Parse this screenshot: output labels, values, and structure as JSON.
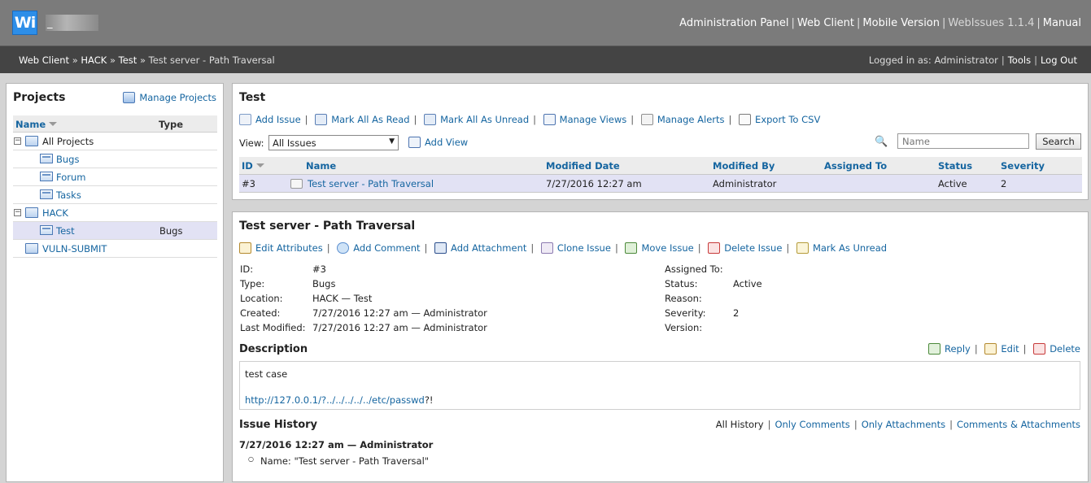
{
  "header": {
    "logo": "Wi",
    "site_title": "_",
    "links": [
      "Administration Panel",
      "Web Client",
      "Mobile Version"
    ],
    "version": "WebIssues 1.1.4",
    "manual": "Manual"
  },
  "breadcrumb": {
    "items": [
      "Web Client",
      "HACK",
      "Test"
    ],
    "current": "Test server - Path Traversal",
    "separator": "»"
  },
  "user": {
    "logged_in": "Logged in as: Administrator",
    "tools": "Tools",
    "logout": "Log Out"
  },
  "projects": {
    "title": "Projects",
    "manage": "Manage Projects",
    "col_name": "Name",
    "col_type": "Type",
    "rows": [
      {
        "label": "All Projects",
        "type": ""
      },
      {
        "label": "Bugs",
        "type": ""
      },
      {
        "label": "Forum",
        "type": ""
      },
      {
        "label": "Tasks",
        "type": ""
      },
      {
        "label": "HACK",
        "type": ""
      },
      {
        "label": "Test",
        "type": "Bugs"
      },
      {
        "label": "VULN-SUBMIT",
        "type": ""
      }
    ]
  },
  "list": {
    "title": "Test",
    "toolbar": [
      "Add Issue",
      "Mark All As Read",
      "Mark All As Unread",
      "Manage Views",
      "Manage Alerts",
      "Export To CSV"
    ],
    "view_label": "View:",
    "view_value": "All Issues",
    "add_view": "Add View",
    "search_placeholder": "Name",
    "search_button": "Search",
    "columns": [
      "ID",
      "Name",
      "Modified Date",
      "Modified By",
      "Assigned To",
      "Status",
      "Severity"
    ],
    "row": {
      "id": "#3",
      "name": "Test server - Path Traversal",
      "modified_date": "7/27/2016 12:27 am",
      "modified_by": "Administrator",
      "assigned_to": "",
      "status": "Active",
      "severity": "2"
    }
  },
  "detail": {
    "title": "Test server - Path Traversal",
    "toolbar": [
      "Edit Attributes",
      "Add Comment",
      "Add Attachment",
      "Clone Issue",
      "Move Issue",
      "Delete Issue",
      "Mark As Unread"
    ],
    "left_attrs": [
      {
        "k": "ID:",
        "v": "#3"
      },
      {
        "k": "Type:",
        "v": "Bugs"
      },
      {
        "k": "Location:",
        "v": "HACK — Test"
      },
      {
        "k": "Created:",
        "v": "7/27/2016 12:27 am — Administrator"
      },
      {
        "k": "Last Modified:",
        "v": "7/27/2016 12:27 am — Administrator"
      }
    ],
    "right_attrs": [
      {
        "k": "Assigned To:",
        "v": ""
      },
      {
        "k": "Status:",
        "v": "Active"
      },
      {
        "k": "Reason:",
        "v": ""
      },
      {
        "k": "Severity:",
        "v": "2"
      },
      {
        "k": "Version:",
        "v": ""
      }
    ],
    "description_title": "Description",
    "desc_actions": [
      "Reply",
      "Edit",
      "Delete"
    ],
    "description_text": "test case",
    "description_link": "http://127.0.0.1/?../../../../../etc/passwd",
    "description_suffix": "?!",
    "history_title": "Issue History",
    "history_filters": [
      "All History",
      "Only Comments",
      "Only Attachments",
      "Comments & Attachments"
    ],
    "history_entry": "7/27/2016 12:27 am — Administrator",
    "history_change": "Name: \"Test server - Path Traversal\""
  },
  "colors": {
    "header_bg": "#7b7b7b",
    "navbar_bg": "#444444",
    "link": "#1565a0",
    "selected_row": "#e2e2f4",
    "logo_blue": "#2d8ee8"
  }
}
